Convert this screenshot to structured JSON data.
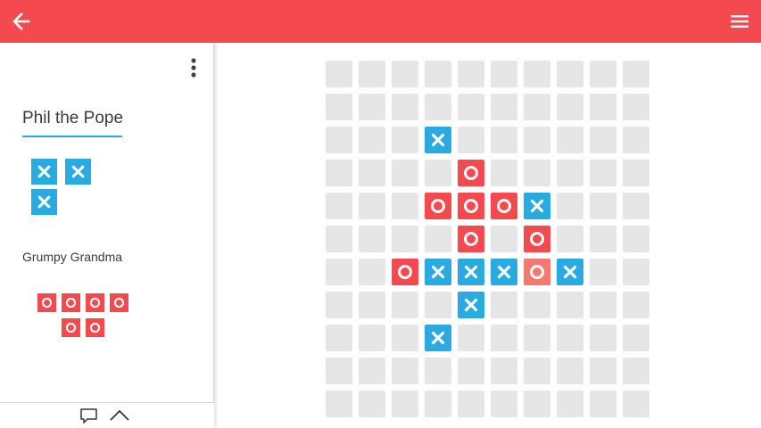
{
  "header": {
    "back_icon": "arrow-left-icon",
    "menu_icon": "hamburger-menu-icon",
    "bar_color": "#f44a4f"
  },
  "players": [
    {
      "name": "Phil the Pope",
      "symbol": "x",
      "pieces_remaining": 3,
      "active": true,
      "color": "#29abe2"
    },
    {
      "name": "Grumpy Grandma",
      "symbol": "o",
      "pieces_remaining": 6,
      "active": false,
      "color": "#f44a4f"
    }
  ],
  "sidebar": {
    "more_icon": "more-vertical-icon",
    "chat_icon": "chat-bubble-icon",
    "expand_icon": "chevron-up-icon"
  },
  "board": {
    "rows": 11,
    "cols": 10,
    "empty_color": "#e6e6e6",
    "cells": [
      "..........",
      "..........",
      "...X......",
      "....O.....",
      "...OOOX...",
      "....O.O...",
      "..OXXXOX..",
      "....X.....",
      "...X......",
      "..........",
      ".........."
    ],
    "last_move": {
      "row": 6,
      "col": 6
    }
  }
}
